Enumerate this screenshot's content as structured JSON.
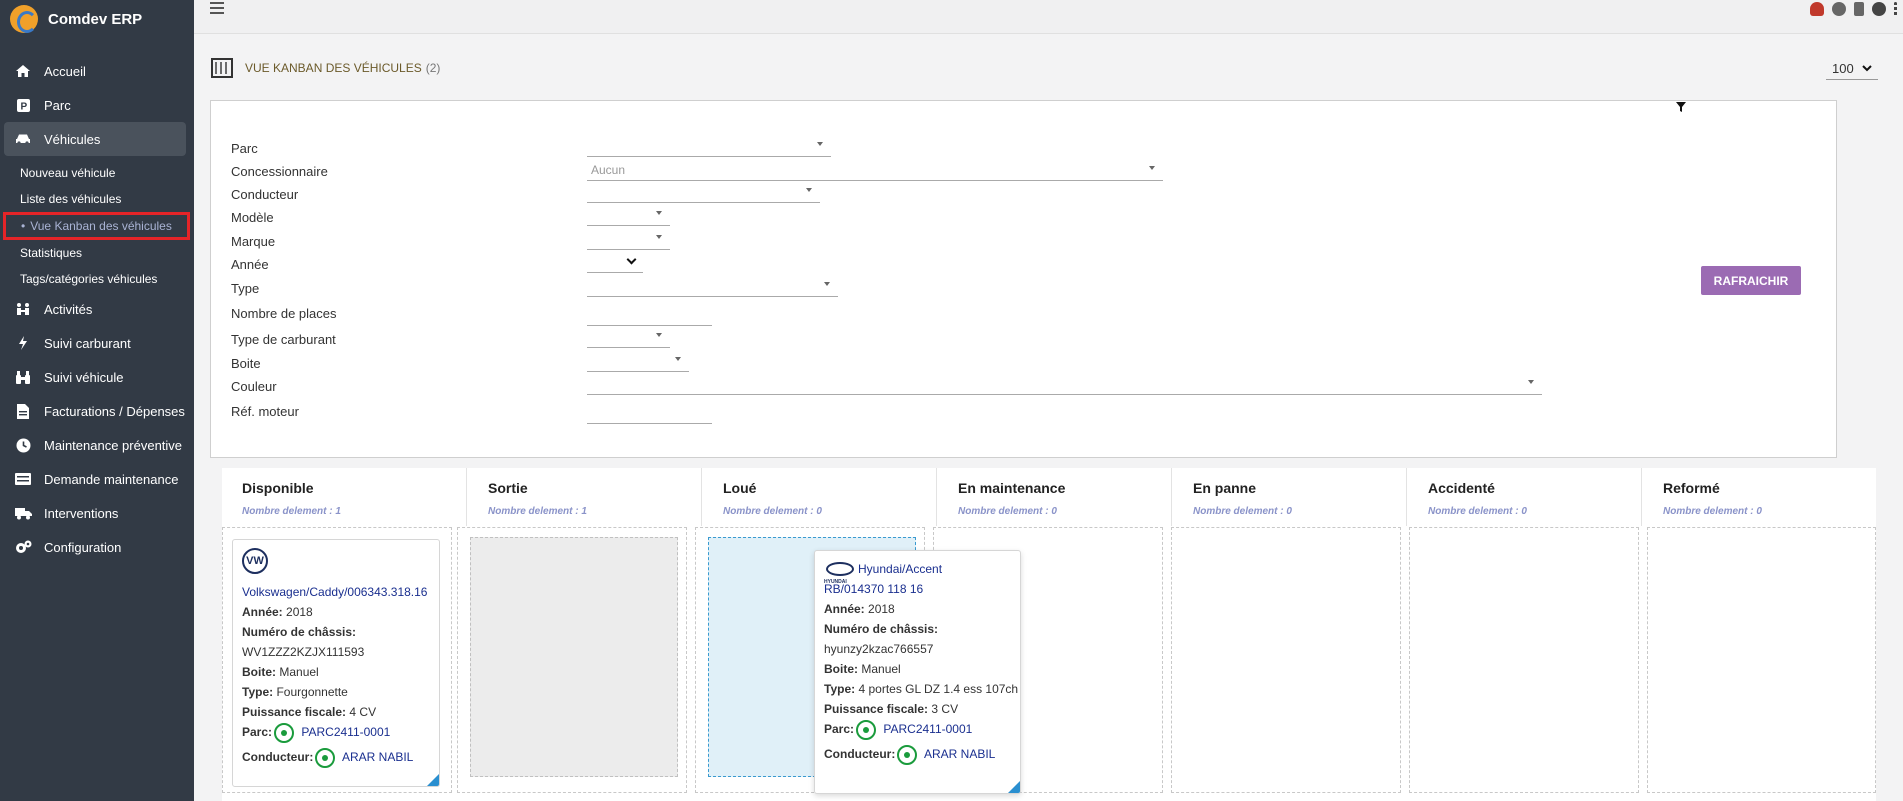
{
  "app": {
    "name": "Comdev ERP"
  },
  "sidebar": {
    "items": [
      {
        "label": "Accueil",
        "icon": "home-icon"
      },
      {
        "label": "Parc",
        "icon": "parking-icon"
      },
      {
        "label": "Véhicules",
        "icon": "car-icon"
      },
      {
        "label": "Activités",
        "icon": "activities-icon"
      },
      {
        "label": "Suivi carburant",
        "icon": "fuel-icon"
      },
      {
        "label": "Suivi véhicule",
        "icon": "binoculars-icon"
      },
      {
        "label": "Facturations / Dépenses",
        "icon": "invoice-icon"
      },
      {
        "label": "Maintenance préventive",
        "icon": "clock-icon"
      },
      {
        "label": "Demande maintenance",
        "icon": "request-icon"
      },
      {
        "label": "Interventions",
        "icon": "truck-icon"
      },
      {
        "label": "Configuration",
        "icon": "gears-icon"
      }
    ],
    "subitems": [
      {
        "label": "Nouveau véhicule"
      },
      {
        "label": "Liste des véhicules"
      },
      {
        "label": "Vue Kanban des véhicules"
      },
      {
        "label": "Statistiques"
      },
      {
        "label": "Tags/catégories véhicules"
      }
    ]
  },
  "header": {
    "title": "VUE KANBAN DES VÉHICULES",
    "count": "(2)",
    "per_page": "100"
  },
  "filters": {
    "labels": {
      "parc": "Parc",
      "concessionnaire": "Concessionnaire",
      "conducteur": "Conducteur",
      "modele": "Modèle",
      "marque": "Marque",
      "annee": "Année",
      "type": "Type",
      "nb_places": "Nombre de places",
      "carburant": "Type de carburant",
      "boite": "Boite",
      "couleur": "Couleur",
      "ref_moteur": "Réf. moteur"
    },
    "concessionnaire_value": "Aucun",
    "refresh_label": "RAFRAICHIR"
  },
  "kanban": {
    "count_prefix": "Nombre delement :",
    "columns": [
      {
        "title": "Disponible",
        "count": "Nombre delement : 1"
      },
      {
        "title": "Sortie",
        "count": "Nombre delement : 1"
      },
      {
        "title": "Loué",
        "count": "Nombre delement : 0"
      },
      {
        "title": "En maintenance",
        "count": "Nombre delement : 0"
      },
      {
        "title": "En panne",
        "count": "Nombre delement : 0"
      },
      {
        "title": "Accidenté",
        "count": "Nombre delement : 0"
      },
      {
        "title": "Reformé",
        "count": "Nombre delement : 0"
      }
    ],
    "cards": [
      {
        "name": "Volkswagen/Caddy/006343.318.16",
        "annee_label": "Année:",
        "annee": "2018",
        "chassis_label": "Numéro de châssis:",
        "chassis": "WV1ZZZ2KZJX111593",
        "boite_label": "Boite:",
        "boite": "Manuel",
        "type_label": "Type:",
        "type": "Fourgonnette",
        "puissance_label": "Puissance fiscale:",
        "puissance": "4 CV",
        "parc_label": "Parc:",
        "parc": "PARC2411-0001",
        "conducteur_label": "Conducteur:",
        "conducteur": "ARAR NABIL"
      },
      {
        "name": "Hyundai/Accent",
        "plate": "RB/014370 118 16",
        "annee_label": "Année:",
        "annee": "2018",
        "chassis_label": "Numéro de châssis:",
        "chassis": "hyunzy2kzac766557",
        "boite_label": "Boite:",
        "boite": "Manuel",
        "type_label": "Type:",
        "type": "4 portes GL DZ 1.4 ess 107ch",
        "puissance_label": "Puissance fiscale:",
        "puissance": "3 CV",
        "parc_label": "Parc:",
        "parc": "PARC2411-0001",
        "conducteur_label": "Conducteur:",
        "conducteur": "ARAR NABIL"
      }
    ]
  },
  "colors": {
    "sidebar_bg": "#323a45",
    "accent": "#9b6bb3",
    "link": "#1a2f8f",
    "whatsapp": "#1a9b3c"
  }
}
